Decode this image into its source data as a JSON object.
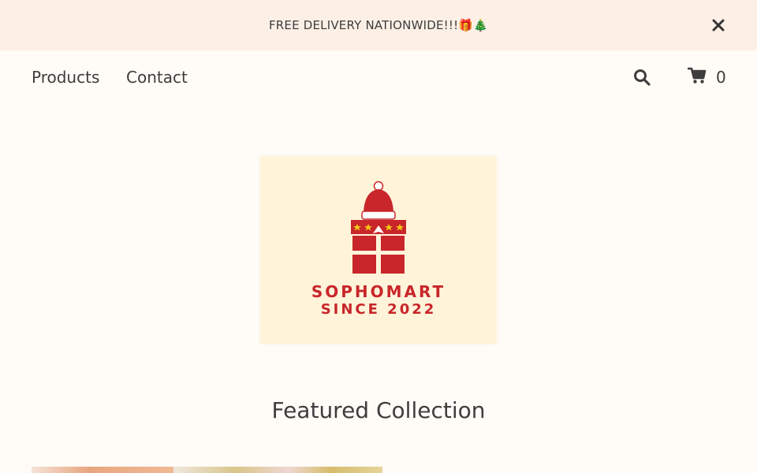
{
  "announcement": {
    "text": "FREE DELIVERY NATIONWIDE!!!🎁🎄",
    "close_icon": "close-icon"
  },
  "nav": {
    "links": [
      "Products",
      "Contact"
    ],
    "search_icon": "search-icon",
    "cart_icon": "cart-icon",
    "cart_count": "0"
  },
  "logo": {
    "name": "SOPHOMART",
    "since": "SINCE 2022",
    "colors": {
      "brand_red": "#c8262a",
      "background": "#fff3da",
      "star": "#f5c518"
    }
  },
  "featured": {
    "title": "Featured Collection"
  },
  "colors": {
    "announcement_bg": "#fcefe6",
    "page_bg": "#fffbf6",
    "text": "#3d3d3d"
  }
}
